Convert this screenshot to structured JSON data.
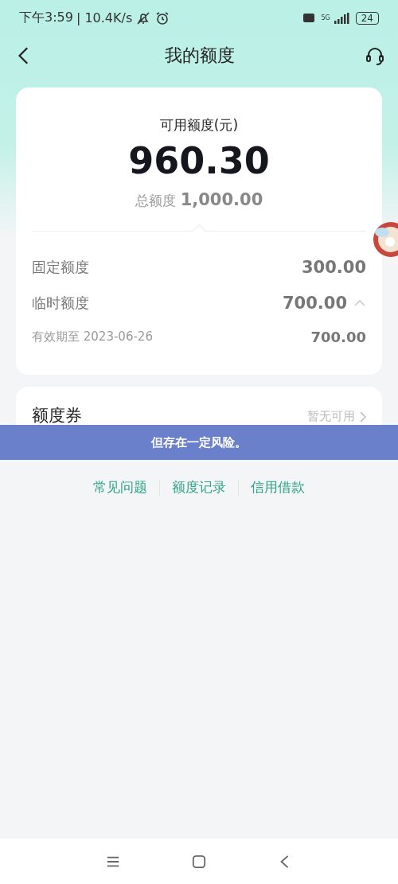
{
  "status_bar": {
    "time": "下午3:59",
    "speed": "| 10.4K/s",
    "network": "5G",
    "battery": "24"
  },
  "nav": {
    "title": "我的额度"
  },
  "summary": {
    "label": "可用额度(元)",
    "amount": "960.30",
    "total_label": "总额度",
    "total": "1,000.00"
  },
  "rows": [
    {
      "label": "固定额度",
      "value": "300.00",
      "kind": "plain"
    },
    {
      "label": "临时额度",
      "value": "700.00",
      "kind": "expandable",
      "expanded": true
    },
    {
      "label": "有效期至 2023-06-26",
      "value": "700.00",
      "kind": "sub"
    }
  ],
  "coupon": {
    "label": "额度券",
    "status": "暂无可用"
  },
  "caption": "但存在一定风险。",
  "links": [
    "常见问题",
    "额度记录",
    "信用借款"
  ]
}
